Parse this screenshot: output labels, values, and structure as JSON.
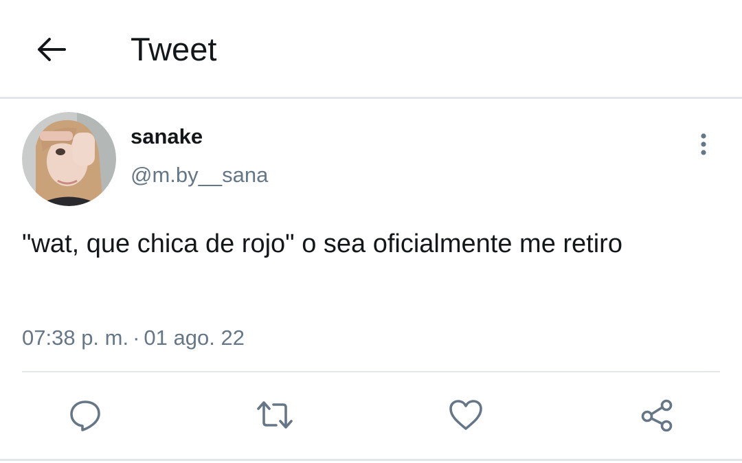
{
  "header": {
    "title": "Tweet",
    "back_icon": "arrow-left-icon"
  },
  "tweet": {
    "author": {
      "display_name": "sanake",
      "handle": "@m.by__sana",
      "avatar_icon": "avatar-photo"
    },
    "text": "\"wat, que chica de rojo\" o sea oficialmente me retiro",
    "time": "07:38 p. m.",
    "separator": "·",
    "date": "01 ago. 22",
    "more_icon": "more-vertical-icon"
  },
  "actions": [
    {
      "name": "reply",
      "icon": "reply-icon"
    },
    {
      "name": "retweet",
      "icon": "retweet-icon"
    },
    {
      "name": "like",
      "icon": "heart-icon"
    },
    {
      "name": "share",
      "icon": "share-icon"
    }
  ],
  "colors": {
    "text_primary": "#14171a",
    "text_secondary": "#657786",
    "icon": "#657786",
    "divider": "#e3e6e8",
    "background": "#ffffff"
  }
}
